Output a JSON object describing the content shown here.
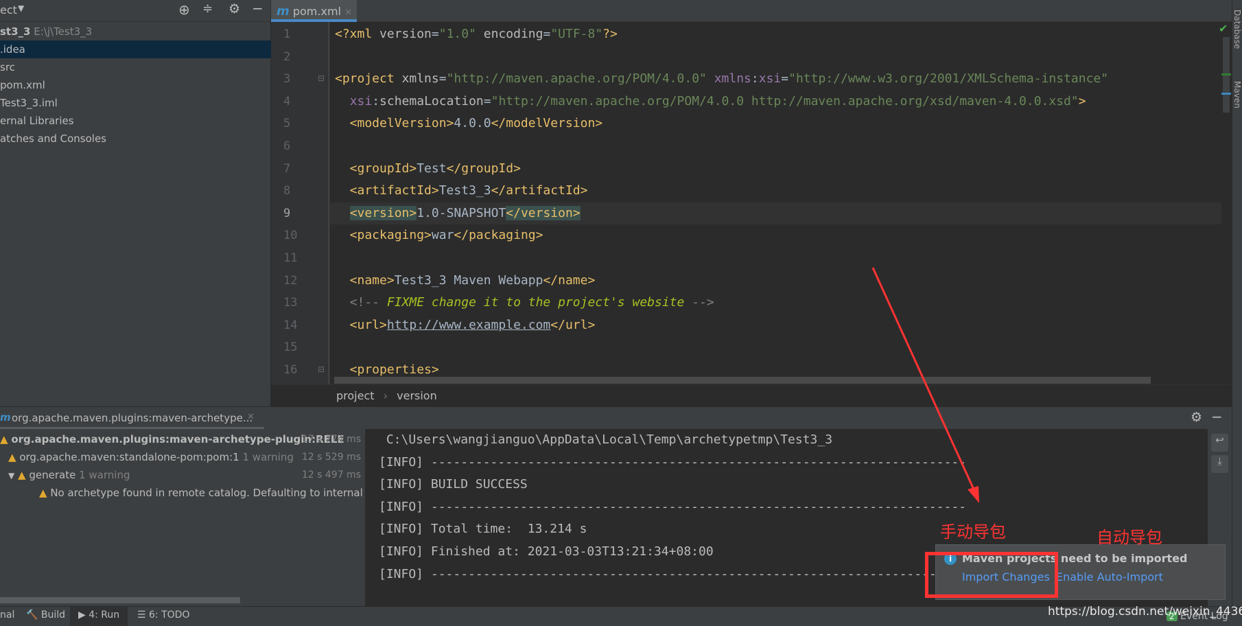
{
  "project_panel": {
    "title": "ect",
    "root": {
      "name": "st3_3",
      "path": "E:\\j\\Test3_3"
    },
    "items": [
      ".idea",
      "src",
      "pom.xml",
      "Test3_3.iml",
      "ernal Libraries",
      "atches and Consoles"
    ],
    "selected_index": 0
  },
  "editor": {
    "tab": {
      "icon": "m",
      "label": "pom.xml"
    },
    "current_line": 9,
    "lines": [
      [
        [
          "t",
          "<?xml "
        ],
        [
          "a",
          "version"
        ],
        [
          "x",
          "="
        ],
        [
          "v",
          "\"1.0\""
        ],
        [
          "a",
          " encoding"
        ],
        [
          "x",
          "="
        ],
        [
          "v",
          "\"UTF-8\""
        ],
        [
          "t",
          "?>"
        ]
      ],
      [],
      [
        [
          "t",
          "<project "
        ],
        [
          "a",
          "xmlns"
        ],
        [
          "x",
          "="
        ],
        [
          "v",
          "\"http://maven.apache.org/POM/4.0.0\""
        ],
        [
          "n",
          " xmlns"
        ],
        [
          "x",
          ":"
        ],
        [
          "n",
          "xsi"
        ],
        [
          "x",
          "="
        ],
        [
          "v",
          "\"http://www.w3.org/2001/XMLSchema-instance\""
        ]
      ],
      [
        [
          "x",
          "  "
        ],
        [
          "n",
          "xsi"
        ],
        [
          "x",
          ":"
        ],
        [
          "a",
          "schemaLocation"
        ],
        [
          "x",
          "="
        ],
        [
          "v",
          "\"http://maven.apache.org/POM/4.0.0 http://maven.apache.org/xsd/maven-4.0.0.xsd\""
        ],
        [
          "t",
          ">"
        ]
      ],
      [
        [
          "t",
          "  <modelVersion>"
        ],
        [
          "x",
          "4.0.0"
        ],
        [
          "t",
          "</modelVersion>"
        ]
      ],
      [],
      [
        [
          "t",
          "  <groupId>"
        ],
        [
          "x",
          "Test"
        ],
        [
          "t",
          "</groupId>"
        ]
      ],
      [
        [
          "t",
          "  <artifactId>"
        ],
        [
          "x",
          "Test3_3"
        ],
        [
          "t",
          "</artifactId>"
        ]
      ],
      [
        [
          "x",
          "  "
        ],
        [
          "m",
          "<version>"
        ],
        [
          "x",
          "1.0-SNAPSHOT"
        ],
        [
          "m",
          "</version>"
        ]
      ],
      [
        [
          "t",
          "  <packaging>"
        ],
        [
          "x",
          "war"
        ],
        [
          "t",
          "</packaging>"
        ]
      ],
      [],
      [
        [
          "t",
          "  <name>"
        ],
        [
          "x",
          "Test3_3 Maven Webapp"
        ],
        [
          "t",
          "</name>"
        ]
      ],
      [
        [
          "c",
          "  <!-- "
        ],
        [
          "f",
          "FIXME change it to the project's website"
        ],
        [
          "c",
          " -->"
        ]
      ],
      [
        [
          "t",
          "  <url>"
        ],
        [
          "u",
          "http://www.example.com"
        ],
        [
          "t",
          "</url>"
        ]
      ],
      [],
      [
        [
          "t",
          "  <properties>"
        ]
      ]
    ],
    "breadcrumb": [
      "project",
      "version"
    ]
  },
  "right_strip": {
    "tabs": [
      "Database",
      "Maven"
    ]
  },
  "run_panel": {
    "tab_label": "org.apache.maven.plugins:maven-archetype...",
    "tree": [
      {
        "label": "org.apache.maven.plugins:maven-archetype-plugin:RELE",
        "extra": "",
        "duration": "17 s 774 ms"
      },
      {
        "label": "org.apache.maven:standalone-pom:pom:1",
        "extra": "1 warning",
        "duration": "12 s 529 ms"
      },
      {
        "label": "generate",
        "extra": "1 warning",
        "duration": "12 s 497 ms"
      },
      {
        "label": "No archetype found in remote catalog. Defaulting to internal c",
        "extra": "",
        "duration": ""
      }
    ],
    "console": [
      " C:\\Users\\wangjianguo\\AppData\\Local\\Temp\\archetypetmp\\Test3_3",
      "[INFO] ------------------------------------------------------------------------",
      "[INFO] BUILD SUCCESS",
      "[INFO] ------------------------------------------------------------------------",
      "[INFO] Total time:  13.214 s",
      "[INFO] Finished at: 2021-03-03T13:21:34+08:00",
      "[INFO] ------------------------------------------------------------------------"
    ]
  },
  "status_bar": {
    "items": [
      "nal",
      "Build",
      "4: Run",
      "6: TODO"
    ],
    "event_log": "Event Log",
    "event_count": "2"
  },
  "notification": {
    "title": "Maven projects need to be imported",
    "import_changes": "Import Changes",
    "enable_auto_import": "Enable Auto-Import"
  },
  "annotations": {
    "manual": "手动导包",
    "auto": "自动导包",
    "color": "#ff3333"
  },
  "watermark": "https://blog.csdn.net/weixin_44368422"
}
